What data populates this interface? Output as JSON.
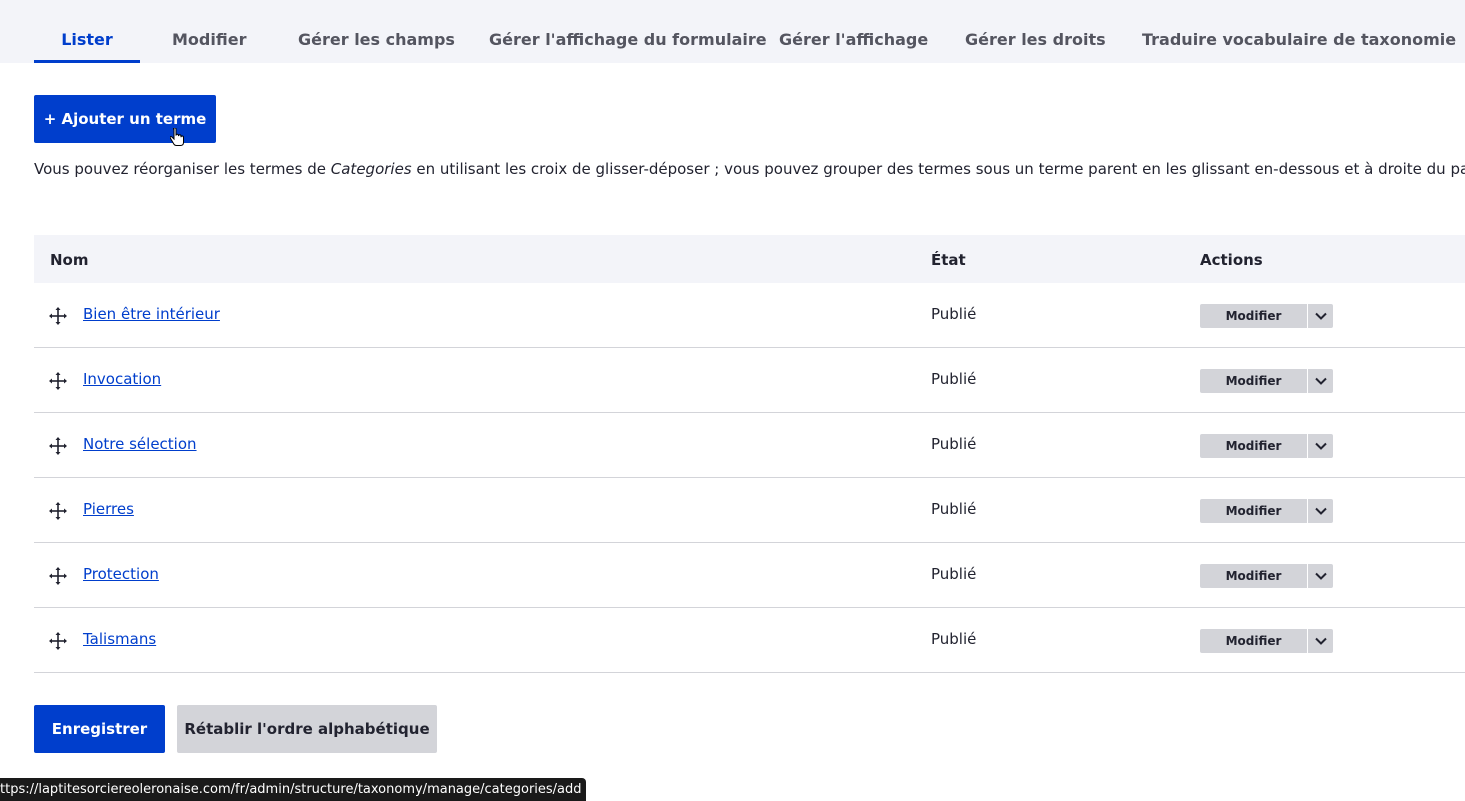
{
  "tabs": [
    {
      "label": "Lister",
      "active": true
    },
    {
      "label": "Modifier",
      "active": false
    },
    {
      "label": "Gérer les champs",
      "active": false
    },
    {
      "label": "Gérer l'affichage du formulaire",
      "active": false
    },
    {
      "label": "Gérer l'affichage",
      "active": false
    },
    {
      "label": "Gérer les droits",
      "active": false
    },
    {
      "label": "Traduire vocabulaire de taxonomie",
      "active": false
    }
  ],
  "add_button": {
    "label": "+ Ajouter un terme"
  },
  "help": {
    "before": "Vous pouvez réorganiser les termes de ",
    "vocabulary": "Categories",
    "after": " en utilisant les croix de glisser-déposer ; vous pouvez grouper des termes sous un terme parent en les glissant en-dessous et à droite du parent."
  },
  "table": {
    "headers": {
      "name": "Nom",
      "state": "État",
      "actions": "Actions"
    },
    "rows": [
      {
        "name": "Bien être intérieur",
        "state": "Publié",
        "action": "Modifier"
      },
      {
        "name": "Invocation",
        "state": "Publié",
        "action": "Modifier"
      },
      {
        "name": "Notre sélection",
        "state": "Publié",
        "action": "Modifier"
      },
      {
        "name": "Pierres",
        "state": "Publié",
        "action": "Modifier"
      },
      {
        "name": "Protection",
        "state": "Publié",
        "action": "Modifier"
      },
      {
        "name": "Talismans",
        "state": "Publié",
        "action": "Modifier"
      }
    ]
  },
  "footer": {
    "save_label": "Enregistrer",
    "reset_label": "Rétablir l'ordre alphabétique"
  },
  "status_url": "ttps://laptitesorciereoleronaise.com/fr/admin/structure/taxonomy/manage/categories/add",
  "colors": {
    "accent": "#003ecc",
    "tabs_bg": "#f3f4f9",
    "secondary_btn": "#d3d4d9"
  }
}
